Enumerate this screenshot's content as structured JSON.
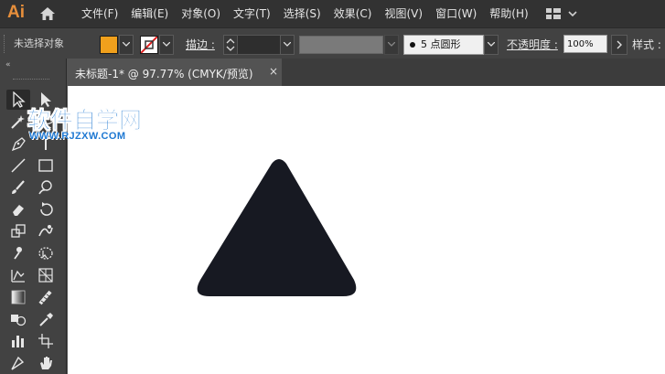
{
  "app": {
    "logo": "Ai"
  },
  "menu": {
    "items": [
      "文件(F)",
      "编辑(E)",
      "对象(O)",
      "文字(T)",
      "选择(S)",
      "效果(C)",
      "视图(V)",
      "窗口(W)",
      "帮助(H)"
    ]
  },
  "control_bar": {
    "selection_status": "未选择对象",
    "fill_color": "#f0a01c",
    "stroke_label": "描边 :",
    "brush_size": "5",
    "brush_label": "点圆形",
    "opacity_label": "不透明度 :",
    "opacity_value": "100%",
    "style_label": "样式 :"
  },
  "document_tab": {
    "title": "未标题-1* @ 97.77% (CMYK/预览)",
    "close_glyph": "×"
  },
  "watermark": {
    "title": "软件自学网",
    "url": "WWW.RJZXW.COM"
  },
  "artwork": {
    "shape": "rounded-triangle",
    "fill": "#171922"
  },
  "icons": {
    "collapse": "«"
  }
}
